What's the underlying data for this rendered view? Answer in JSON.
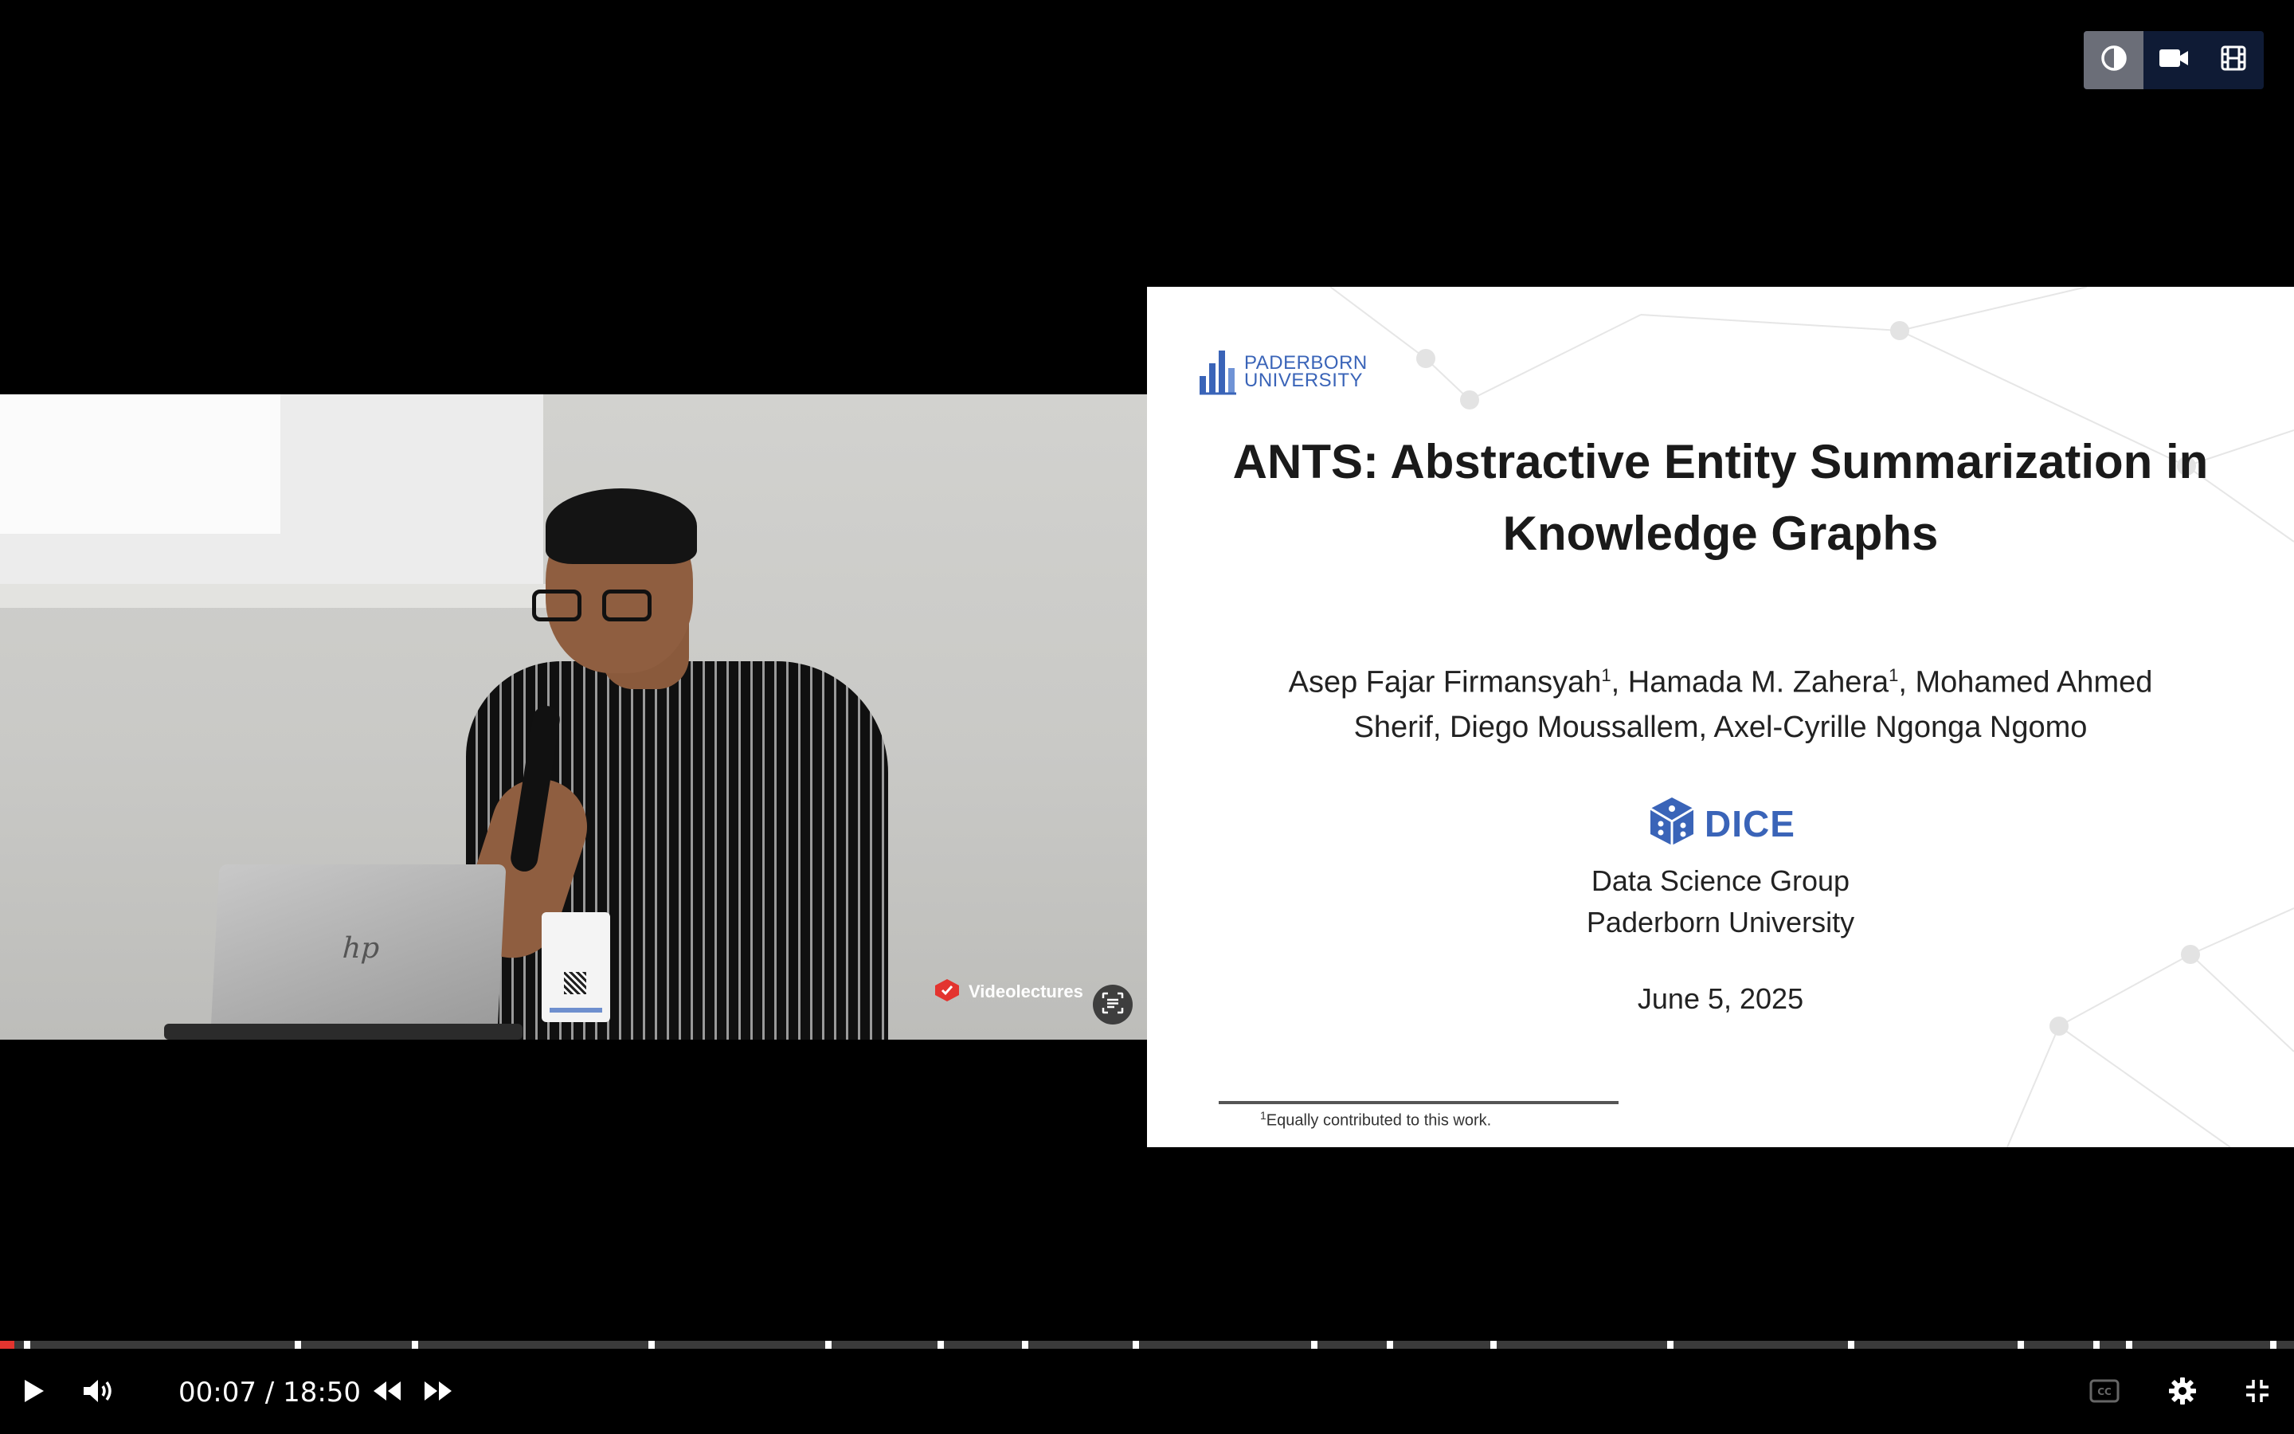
{
  "player": {
    "layout_toggles": [
      {
        "id": "contrast",
        "icon": "contrast-icon",
        "active": true
      },
      {
        "id": "video",
        "icon": "video-camera-icon",
        "active": false
      },
      {
        "id": "film",
        "icon": "film-icon",
        "active": false
      }
    ],
    "watermark": {
      "name": "Videolectures",
      "icon": "videolectures-logo-icon"
    },
    "scan_button_icon": "scan-text-icon"
  },
  "slide": {
    "university": "PADERBORN UNIVERSITY",
    "title_line1": "ANTS: Abstractive Entity Summarization in",
    "title_line2": "Knowledge Graphs",
    "authors_line1_a": "Asep Fajar Firmansyah",
    "authors_line1_b": ", Hamada M. Zahera",
    "authors_line1_c": ", Mohamed Ahmed",
    "authors_sup": "1",
    "authors_line2": "Sherif, Diego Moussallem, Axel-Cyrille Ngonga Ngomo",
    "group_logo": "DICE",
    "group_line1": "Data Science Group",
    "group_line2": "Paderborn University",
    "date": "June 5, 2025",
    "footnote_sup": "1",
    "footnote": "Equally contributed to this work."
  },
  "progress": {
    "played_fraction": 0.0063,
    "chapter_markers": [
      0.0118,
      0.13,
      0.181,
      0.284,
      0.361,
      0.41,
      0.447,
      0.495,
      0.573,
      0.606,
      0.651,
      0.728,
      0.807,
      0.881,
      0.914,
      0.928,
      0.991
    ]
  },
  "controls": {
    "current_time": "00:07",
    "separator": "/",
    "duration": "18:50",
    "play_icon": "play-icon",
    "volume_icon": "volume-icon",
    "rewind_icon": "rewind-icon",
    "forward_icon": "fast-forward-icon",
    "captions_icon": "closed-captions-icon",
    "settings_icon": "gear-icon",
    "exit_fullscreen_icon": "exit-fullscreen-icon"
  },
  "colors": {
    "accent": "#e3342f",
    "toggle_bg": "#0f1b35",
    "toggle_active": "#6b6e78",
    "slide_brand_blue": "#3a64b8"
  }
}
